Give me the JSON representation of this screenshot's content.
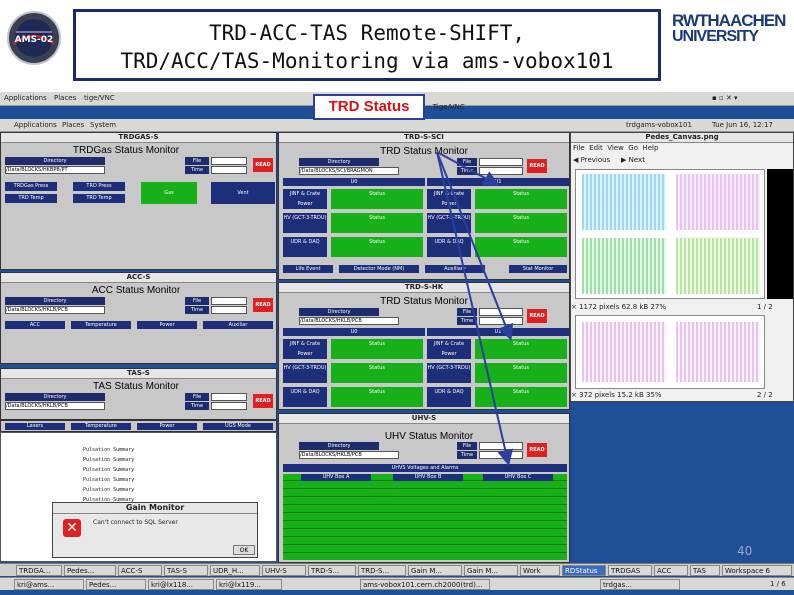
{
  "slide": {
    "title_line1": "TRD-ACC-TAS Remote-SHIFT,",
    "title_line2": "TRD/ACC/TAS-Monitoring via ams-vobox101",
    "callout": "TRD Status",
    "page_number": "40",
    "logo_ams_text": "AMS-02",
    "logo_rwth_text1": "RWTHAACHEN",
    "logo_rwth_text2": "UNIVERSITY"
  },
  "desktop": {
    "outer_menu": [
      "Applications",
      "Places",
      "tige/VNC"
    ],
    "outer_title": "- Tige/VNC",
    "inner_menu": [
      "Applications",
      "Places",
      "System"
    ],
    "inner_title": "trdgams-vobox101",
    "clock": "Tue Jun 16, 12:17"
  },
  "windows": {
    "trdgas": {
      "title": "TRDGAS-S",
      "monitor": "TRDGas Status Monitor",
      "dir_label": "Directory",
      "path": "/Data/BLOCKS/HKBPB/PT",
      "file_label": "File",
      "time_label": "Time",
      "read": "READ",
      "row1": [
        "TRDGas Press",
        "TRD Press",
        "Gas",
        ""
      ],
      "row2": [
        "TRD Temp",
        "TRD Temp",
        "Vent",
        ""
      ]
    },
    "acc": {
      "title": "ACC-S",
      "monitor": "ACC Status Monitor",
      "dir_label": "Directory",
      "path": "/Data/BLOCKS/HKLB/PCB",
      "file_label": "File",
      "time_label": "Time",
      "read": "READ",
      "row": [
        "ACC",
        "Temperature",
        "Power",
        "Auxiliar"
      ]
    },
    "tas": {
      "title": "TAS-S",
      "monitor": "TAS Status Monitor",
      "dir_label": "Directory",
      "path": "/Data/BLOCKS/HKLB/PCB",
      "file_label": "File",
      "time_label": "Time",
      "read": "READ",
      "row": [
        "Lasers",
        "Temperature",
        "Power",
        "UGS Mode"
      ]
    },
    "log": {
      "lines": [
        "Pulsation Summary",
        "Pulsation Summary",
        "Pulsation Summary",
        "Pulsation Summary",
        "Pulsation Summary",
        "Pulsation Summary"
      ]
    },
    "gain": {
      "title": "Gain Monitor",
      "message": "Can't connect to SQL Server",
      "ok": "OK"
    },
    "trd_sci": {
      "title": "TRD-S-SCI",
      "monitor": "TRD Status Monitor",
      "dir_label": "Directory",
      "path": "/Data/BLOCKS/SCI/BRAGMON",
      "file_label": "File",
      "time_label": "Time",
      "read": "READ",
      "s0": "U0",
      "s1": "U1",
      "rows": [
        "JINF & Crate Power",
        "HV (GCT-3-TRDU)",
        "UDR & DAQ"
      ],
      "sub": [
        "Status",
        "Status",
        "Status"
      ],
      "bottom": [
        "Life Event",
        "Detector Mode (NM)",
        "Auxiliary",
        "Stat Monitor"
      ]
    },
    "trd_hk": {
      "title": "TRD-S-HK",
      "monitor": "TRD Status Monitor",
      "dir_label": "Directory",
      "path": "/Data/BLOCKS/HKLB/PCB",
      "file_label": "File",
      "time_label": "Time",
      "read": "READ",
      "s0": "U0",
      "s1": "U1",
      "rows": [
        "JINF & Crate Power",
        "HV (GCT-3-TRDU)",
        "UDR & DAQ"
      ],
      "sub": [
        "Status",
        "Status",
        "Status"
      ]
    },
    "uhv": {
      "title": "UHV-S",
      "monitor": "UHV Status Monitor",
      "dir_label": "Directory",
      "path": "/Data/BLOCKS/HKLB/PCB",
      "file_label": "File",
      "time_label": "Time",
      "read": "READ",
      "table_title": "UHVS Voltages and Alarms",
      "col_a": "UHV Box A",
      "col_b": "UHV Box B",
      "col_c": "UHV Box C"
    },
    "pedes": {
      "title": "Pedes_Canvas.png",
      "menu": [
        "File",
        "Edit",
        "View",
        "Go",
        "Help"
      ],
      "prev": "Previous",
      "next": "Next",
      "info1": "× 1172 pixels  62.8 kB  27%",
      "page1": "1 / 2",
      "info2": "× 372 pixels  15.2 kB  35%",
      "page2": "2 / 2"
    }
  },
  "taskbar_outer": [
    "TRDGA...",
    "Pedes...",
    "ACC-S",
    "TAS-S",
    "UDR_H...",
    "UHV-S",
    "TRD-S...",
    "TRD-S...",
    "Gain M...",
    "Gain M...",
    "Work",
    "RDStatus",
    "TRDGAS",
    "ACC",
    "TAS",
    "Workspace 6"
  ],
  "taskbar_inner": [
    "kri@ams...",
    "Pedes...",
    "kri@lx118...",
    "kri@lx119...",
    "ams-vobox101.cern.ch2000(trd)...",
    "trdgas..."
  ],
  "taskbar_page": "1 / 6"
}
